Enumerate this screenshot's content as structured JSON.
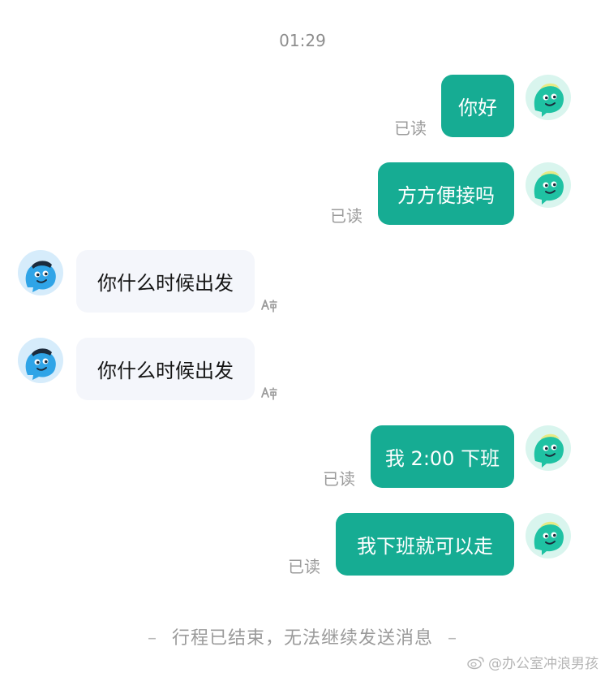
{
  "timestamp": "01:29",
  "messages": [
    {
      "side": "out",
      "text": "你好",
      "status": "已读"
    },
    {
      "side": "out",
      "text": "方方便接吗",
      "status": "已读"
    },
    {
      "side": "in",
      "text": "你什么时候出发"
    },
    {
      "side": "in",
      "text": "你什么时候出发"
    },
    {
      "side": "out",
      "text": "我 2:00 下班",
      "status": "已读"
    },
    {
      "side": "out",
      "text": "我下班就可以走",
      "status": "已读"
    }
  ],
  "footer": {
    "dash_left": "–",
    "notice": "行程已结束，无法继续发送消息",
    "dash_right": "–"
  },
  "watermark": "@办公室冲浪男孩",
  "icons": {
    "self_avatar": "green-cartoon-avatar",
    "other_avatar": "blue-cartoon-avatar",
    "translate": "translate-icon",
    "watermark_logo": "weibo-logo-icon"
  },
  "colors": {
    "outgoing_bubble": "#16ac93",
    "incoming_bubble": "#f4f6fb",
    "muted_text": "#9b9b9b"
  }
}
